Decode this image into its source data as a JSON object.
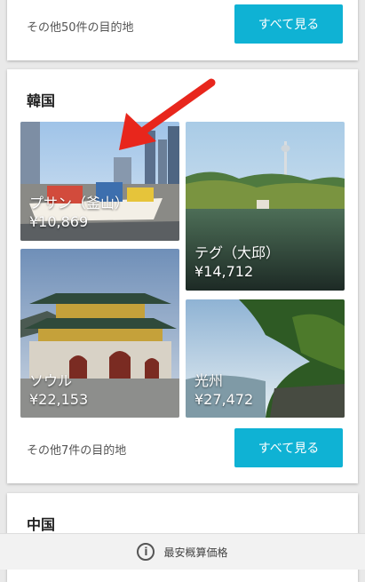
{
  "card_prev": {
    "more_text": "その他50件の目的地",
    "button_label": "すべて見る"
  },
  "korea": {
    "title": "韓国",
    "tiles": [
      {
        "name": "プサン（釜山）",
        "price": "¥10,869"
      },
      {
        "name": "テグ（大邱）",
        "price": "¥14,712"
      },
      {
        "name": "ソウル",
        "price": "¥22,153"
      },
      {
        "name": "光州",
        "price": "¥27,472"
      }
    ],
    "more_text": "その他7件の目的地",
    "button_label": "すべて見る"
  },
  "china": {
    "title": "中国"
  },
  "bottom_bar": {
    "label": "最安概算価格",
    "icon": "info-icon"
  },
  "annotation": {
    "arrow_color": "#e8261c"
  }
}
